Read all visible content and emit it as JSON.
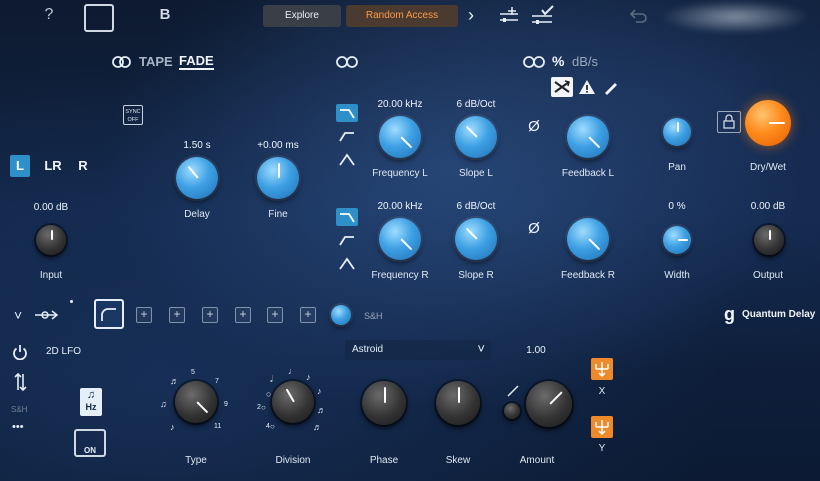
{
  "topbar": {
    "help": "?",
    "preset_b": "B",
    "tab_explore": "Explore",
    "tab_random_access": "Random Access",
    "arrow": "›"
  },
  "header": {
    "tape": "TAPE",
    "fade": "FADE",
    "percent": "%",
    "dbs": "dB/s"
  },
  "sync_button": {
    "line1": "SYNC",
    "line2": "OFF"
  },
  "channels": {
    "l": "L",
    "lr": "LR",
    "r": "R"
  },
  "input": {
    "value": "0.00 dB",
    "label": "Input"
  },
  "delay": {
    "value": "1.50 s",
    "label": "Delay"
  },
  "fine": {
    "value": "+0.00 ms",
    "label": "Fine"
  },
  "row_l": {
    "frequency_value": "20.00 kHz",
    "frequency_label": "Frequency L",
    "slope_value": "6 dB/Oct",
    "slope_label": "Slope L",
    "phase_symbol": "Ø",
    "feedback_label": "Feedback L",
    "pan_label": "Pan"
  },
  "row_r": {
    "frequency_value": "20.00 kHz",
    "frequency_label": "Frequency R",
    "slope_value": "6 dB/Oct",
    "slope_label": "Slope R",
    "phase_symbol": "Ø",
    "feedback_label": "Feedback R",
    "width_value": "0 %",
    "width_label": "Width"
  },
  "drywet": {
    "label": "Dry/Wet"
  },
  "output": {
    "value": "0.00 dB",
    "label": "Output"
  },
  "mod_strip": {
    "chevron": "˅",
    "slot": "+",
    "sh": "S&H",
    "brand": "Quantum Delay",
    "brand_mark": "g"
  },
  "lfo": {
    "title": "2D LFO",
    "sh": "S&H",
    "dots": "•••",
    "hz": "Hz",
    "on": "ON",
    "shape_value": "Astroid",
    "amount_value": "1.00",
    "type_label": "Type",
    "division_label": "Division",
    "phase_label": "Phase",
    "skew_label": "Skew",
    "amount_label": "Amount",
    "x_label": "X",
    "y_label": "Y",
    "type_ticks": [
      "5",
      "7",
      "9",
      "11"
    ],
    "division_ticks": [
      "2",
      "4"
    ]
  },
  "colors": {
    "accent_blue": "#2f8fc8",
    "accent_orange": "#ff8a1c",
    "mod_orange": "#ee8a2a"
  }
}
